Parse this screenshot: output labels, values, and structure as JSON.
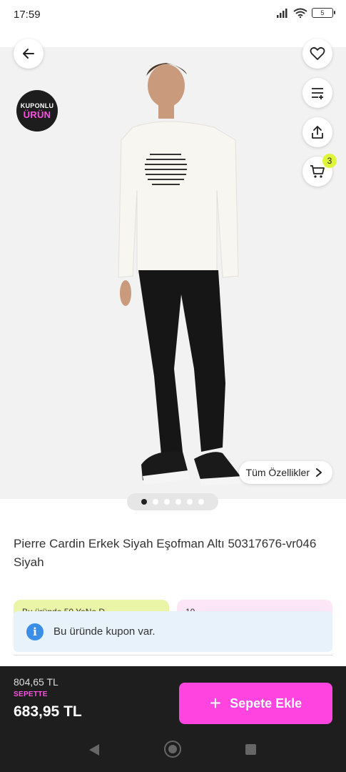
{
  "status_bar": {
    "time": "17:59",
    "battery": "5",
    "icons": [
      "signal-icon",
      "wifi-icon",
      "battery-icon"
    ]
  },
  "header_actions": {
    "back_icon": "arrow-left-icon",
    "favorite_icon": "heart-icon",
    "filter_icon": "filter-lines-icon",
    "share_icon": "share-icon",
    "cart_icon": "cart-icon",
    "cart_count": "3"
  },
  "coupon_badge": {
    "line1": "KUPONLU",
    "line2": "ÜRÜN"
  },
  "image_overlay": {
    "features_button": "Tüm Özellikler"
  },
  "carousel": {
    "total": 6,
    "active_index": 0
  },
  "product": {
    "title": "Pierre Cardin Erkek Siyah Eşofman Altı 50317676-vr046 Siyah"
  },
  "promo_cards": [
    {
      "text": "Bu üründe 50 YeNe D..."
    },
    {
      "text": "10 ..."
    }
  ],
  "coupon_info": {
    "text": "Bu üründe kupon var."
  },
  "pricing": {
    "old_price": "804,65 TL",
    "cart_label": "SEPETTE",
    "final_price": "683,95 TL",
    "add_to_cart": "Sepete Ekle"
  },
  "colors": {
    "accent_pink": "#ff44e0",
    "badge_yellow": "#dff53a",
    "info_blue": "#3a8ee6",
    "bottom_bar": "#1e1e1e"
  }
}
